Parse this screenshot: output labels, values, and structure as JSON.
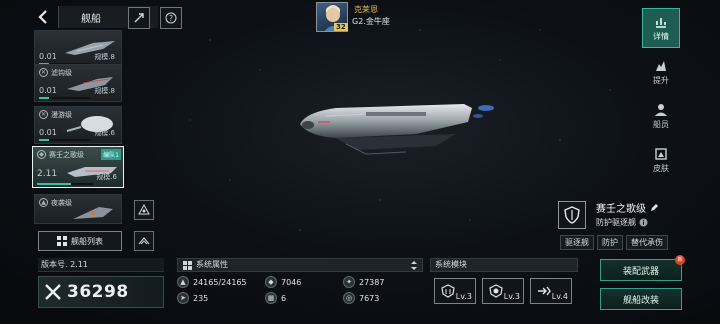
{
  "header": {
    "title": "舰船",
    "icons": [
      "back-chevron-icon",
      "ship-icon",
      "help-icon"
    ]
  },
  "commander": {
    "name": "克莱恩",
    "rank": "G2.金牛座",
    "level": "32"
  },
  "ship_list": {
    "items": [
      {
        "name": "",
        "value": "0.01",
        "tier": "规模.8",
        "progress": 0.2
      },
      {
        "name": "滤钩级",
        "value": "0.01",
        "tier": "规模.8",
        "progress": 0.2
      },
      {
        "name": "漫游级",
        "value": "0.01",
        "tier": "规模.6",
        "progress": 0.2
      },
      {
        "name": "赛壬之歌级",
        "value": "2.11",
        "tier": "规模.6",
        "team": "编队1",
        "progress": 0.6,
        "selected": true
      },
      {
        "name": "夜袭级",
        "value": "",
        "tier": "",
        "progress": 0
      }
    ],
    "list_button": "舰船列表"
  },
  "version": {
    "label": "版本号. 2.11"
  },
  "power": {
    "value": "36298"
  },
  "stats": {
    "title": "系统属性",
    "items": [
      {
        "icon": "armor-icon",
        "value": "24165/24165"
      },
      {
        "icon": "shield-icon",
        "value": "7046"
      },
      {
        "icon": "attack-icon",
        "value": "27387"
      },
      {
        "icon": "speed-icon",
        "value": "235"
      },
      {
        "icon": "grid-icon",
        "value": "6"
      },
      {
        "icon": "energy-icon",
        "value": "7673"
      }
    ]
  },
  "modules": {
    "title": "系统模块",
    "items": [
      {
        "icon": "weapon-module-icon",
        "level": "Lv.3"
      },
      {
        "icon": "defense-module-icon",
        "level": "Lv.3"
      },
      {
        "icon": "engine-module-icon",
        "level": "Lv.4"
      }
    ]
  },
  "ship_info": {
    "name": "赛壬之歌级",
    "role": "防护驱逐舰",
    "tags": [
      "驱逐舰",
      "防护",
      "替代承伤"
    ]
  },
  "actions": {
    "equip_weapon": "装配武器",
    "modify_ship": "舰船改装",
    "badge": "新"
  },
  "right_nav": [
    {
      "label": "详情",
      "icon": "details-icon",
      "active": true
    },
    {
      "label": "提升",
      "icon": "upgrade-icon",
      "active": false
    },
    {
      "label": "船员",
      "icon": "crew-icon",
      "active": false
    },
    {
      "label": "皮肤",
      "icon": "skin-icon",
      "active": false
    }
  ],
  "colors": {
    "accent": "#38c0a3",
    "active_nav": "#1f5d52",
    "commander_name": "#e7b64a",
    "badge": "#d8442e"
  }
}
